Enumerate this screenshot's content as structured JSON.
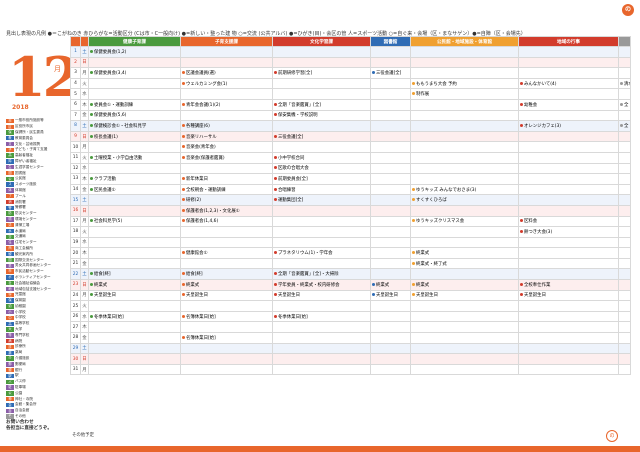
{
  "header": {
    "note": "見出し表現の凡例 ●＝こがねのき 赤ひらがな=活動区分 (Cは市・C一般向け) ●=新しい・整った建 物 ○=交流 (公共アルバ) ●=ひがき(目)・会区の管 人=スポーツ活動 ○=自ぐ来・会場（区・まなサゲン）●=自陣（区・会場先）"
  },
  "brand": {
    "logo_text": "の"
  },
  "sidebar": {
    "month": "12",
    "month_suffix": "月",
    "year": "2018",
    "legend": [
      {
        "key": "市",
        "label": "一般市役所施設等",
        "color": "#e8662c"
      },
      {
        "key": "区",
        "label": "区役所市民",
        "color": "#e8662c"
      },
      {
        "key": "保",
        "label": "保健所・民生委員",
        "color": "#4a9a3e"
      },
      {
        "key": "教",
        "label": "教育委員会",
        "color": "#2f6cb5"
      },
      {
        "key": "文",
        "label": "文化・芸術振興",
        "color": "#8b5ea8"
      },
      {
        "key": "子",
        "label": "子ども・子育て支援",
        "color": "#e8662c"
      },
      {
        "key": "高",
        "label": "高齢者福祉",
        "color": "#4a9a3e"
      },
      {
        "key": "障",
        "label": "障がい者福祉",
        "color": "#2f6cb5"
      },
      {
        "key": "生",
        "label": "生涯学習センター",
        "color": "#8b5ea8"
      },
      {
        "key": "図",
        "label": "図書館",
        "color": "#e8662c"
      },
      {
        "key": "公",
        "label": "公民館",
        "color": "#4a9a3e"
      },
      {
        "key": "ス",
        "label": "スポーツ施設",
        "color": "#2f6cb5"
      },
      {
        "key": "体",
        "label": "体育館",
        "color": "#8b5ea8"
      },
      {
        "key": "プ",
        "label": "プール",
        "color": "#e8662c"
      },
      {
        "key": "消",
        "label": "消防署",
        "color": "#d23c2c"
      },
      {
        "key": "警",
        "label": "警察署",
        "color": "#2f6cb5"
      },
      {
        "key": "防",
        "label": "防災センター",
        "color": "#4a9a3e"
      },
      {
        "key": "環",
        "label": "環境センター",
        "color": "#8b5ea8"
      },
      {
        "key": "清",
        "label": "清掃工場",
        "color": "#e8662c"
      },
      {
        "key": "水",
        "label": "水道局",
        "color": "#2f6cb5"
      },
      {
        "key": "交",
        "label": "交通局",
        "color": "#4a9a3e"
      },
      {
        "key": "住",
        "label": "住宅センター",
        "color": "#8b5ea8"
      },
      {
        "key": "商",
        "label": "商工会議所",
        "color": "#e8662c"
      },
      {
        "key": "観",
        "label": "観光案内所",
        "color": "#2f6cb5"
      },
      {
        "key": "国",
        "label": "国際交流センター",
        "color": "#4a9a3e"
      },
      {
        "key": "男",
        "label": "男女共同参画センター",
        "color": "#8b5ea8"
      },
      {
        "key": "市",
        "label": "市民活動センター",
        "color": "#e8662c"
      },
      {
        "key": "ボ",
        "label": "ボランティアセンター",
        "color": "#2f6cb5"
      },
      {
        "key": "社",
        "label": "社会福祉協議会",
        "color": "#4a9a3e"
      },
      {
        "key": "地",
        "label": "地域包括支援センター",
        "color": "#8b5ea8"
      },
      {
        "key": "児",
        "label": "児童館",
        "color": "#e8662c"
      },
      {
        "key": "保",
        "label": "保育園",
        "color": "#2f6cb5"
      },
      {
        "key": "幼",
        "label": "幼稚園",
        "color": "#4a9a3e"
      },
      {
        "key": "小",
        "label": "小学校",
        "color": "#8b5ea8"
      },
      {
        "key": "中",
        "label": "中学校",
        "color": "#e8662c"
      },
      {
        "key": "高",
        "label": "高等学校",
        "color": "#2f6cb5"
      },
      {
        "key": "大",
        "label": "大学",
        "color": "#4a9a3e"
      },
      {
        "key": "専",
        "label": "専門学校",
        "color": "#8b5ea8"
      },
      {
        "key": "病",
        "label": "病院",
        "color": "#d23c2c"
      },
      {
        "key": "診",
        "label": "診療所",
        "color": "#e8662c"
      },
      {
        "key": "薬",
        "label": "薬局",
        "color": "#2f6cb5"
      },
      {
        "key": "介",
        "label": "介護施設",
        "color": "#4a9a3e"
      },
      {
        "key": "郵",
        "label": "郵便局",
        "color": "#8b5ea8"
      },
      {
        "key": "銀",
        "label": "銀行",
        "color": "#e8662c"
      },
      {
        "key": "駅",
        "label": "駅",
        "color": "#2f6cb5"
      },
      {
        "key": "バ",
        "label": "バス停",
        "color": "#4a9a3e"
      },
      {
        "key": "駐",
        "label": "駐車場",
        "color": "#8b5ea8"
      },
      {
        "key": "公",
        "label": "公園",
        "color": "#4a9a3e"
      },
      {
        "key": "神",
        "label": "神社・寺院",
        "color": "#e8662c"
      },
      {
        "key": "会",
        "label": "会館・集会所",
        "color": "#2f6cb5"
      },
      {
        "key": "自",
        "label": "自治会館",
        "color": "#8b5ea8"
      },
      {
        "key": "そ",
        "label": "その他",
        "color": "#999999"
      }
    ],
    "contact": "お問い合わせ\n各担当に直接どうぞ。"
  },
  "columns": [
    {
      "label": "",
      "color": "#e8662c"
    },
    {
      "label": "",
      "color": "#e8662c"
    },
    {
      "label": "健康子育課",
      "color": "#4a9a3e"
    },
    {
      "label": "子育支援課",
      "color": "#e8662c"
    },
    {
      "label": "文化学習課",
      "color": "#d23c2c"
    },
    {
      "label": "図書館",
      "color": "#2f6cb5"
    },
    {
      "label": "公民館・地域施設・体育館",
      "color": "#f0a030"
    },
    {
      "label": "地域の行事",
      "color": "#d23c2c"
    },
    {
      "label": "",
      "color": "#999999"
    }
  ],
  "days": [
    {
      "d": "1",
      "wd": "土",
      "type": "sat",
      "c": [
        "保健委員会(1,2)",
        "",
        "",
        "",
        "",
        "",
        ""
      ]
    },
    {
      "d": "2",
      "wd": "日",
      "type": "sun",
      "c": [
        "",
        "",
        "",
        "",
        "",
        "",
        ""
      ]
    },
    {
      "d": "3",
      "wd": "月",
      "type": "",
      "c": [
        "保健委員会(3,4)",
        "区議会議員(選)",
        "前期研修学習[全]",
        "三役会議[全]",
        "",
        "",
        ""
      ]
    },
    {
      "d": "4",
      "wd": "火",
      "type": "",
      "c": [
        "",
        "ウェルカミング会(1)",
        "",
        "",
        "ももうまち大会 予約",
        "みんなかいて(4)",
        "清水ラッシュ体操"
      ]
    },
    {
      "d": "5",
      "wd": "水",
      "type": "",
      "c": [
        "",
        "",
        "",
        "",
        "制作展",
        "",
        ""
      ]
    },
    {
      "d": "6",
      "wd": "木",
      "type": "",
      "c": [
        "委員会①・運動訓練",
        "青年会会議(1)(2)",
        "全期「音楽鑑賞」[全]",
        "",
        "",
        "幼稚会",
        "全"
      ]
    },
    {
      "d": "7",
      "wd": "金",
      "type": "",
      "c": [
        "保健委員会(5,6)",
        "",
        "保安集機・学校説明",
        "",
        "",
        "",
        ""
      ]
    },
    {
      "d": "8",
      "wd": "土",
      "type": "sat",
      "c": [
        "保健検診会①・社会科見学",
        "各種講座(6)",
        "",
        "",
        "",
        "オレンジカフェ(3)",
        "全"
      ]
    },
    {
      "d": "9",
      "wd": "日",
      "type": "sun",
      "c": [
        "校長会議(1)",
        "音楽リハーサル",
        "三役会議[全]",
        "",
        "",
        "",
        ""
      ]
    },
    {
      "d": "10",
      "wd": "月",
      "type": "",
      "c": [
        "",
        "音楽会(青年会)",
        "",
        "",
        "",
        "",
        ""
      ]
    },
    {
      "d": "11",
      "wd": "火",
      "type": "",
      "c": [
        "土曜授業・小学自由活動",
        "音楽会(保護者鑑賞)",
        "小中学校合同",
        "",
        "",
        "",
        ""
      ]
    },
    {
      "d": "12",
      "wd": "水",
      "type": "",
      "c": [
        "",
        "",
        "区歌の合唱大会",
        "",
        "",
        "",
        ""
      ]
    },
    {
      "d": "13",
      "wd": "木",
      "type": "",
      "c": [
        "クラブ活動",
        "新年休業日",
        "前期委員会[全]",
        "",
        "",
        "",
        ""
      ]
    },
    {
      "d": "14",
      "wd": "金",
      "type": "",
      "c": [
        "区民会議①",
        "全校朝会・運動訓練",
        "合唱練習",
        "",
        "ゆうキッズ みんなでおさま(3)",
        "",
        ""
      ]
    },
    {
      "d": "15",
      "wd": "土",
      "type": "sat",
      "c": [
        "",
        "研修(2)",
        "運動集団[全]",
        "",
        "すくすくひろば",
        "",
        ""
      ]
    },
    {
      "d": "16",
      "wd": "日",
      "type": "sun",
      "c": [
        "",
        "保護者会(1,2,3)・文化展①",
        "",
        "",
        "",
        "",
        ""
      ]
    },
    {
      "d": "17",
      "wd": "月",
      "type": "",
      "c": [
        "社会科見学(5)",
        "保護者会(1,4,6)",
        "",
        "",
        "ゆうキッズクリスマス会",
        "区料会",
        ""
      ]
    },
    {
      "d": "18",
      "wd": "火",
      "type": "",
      "c": [
        "",
        "",
        "",
        "",
        "",
        "餅つき大会(3)",
        ""
      ]
    },
    {
      "d": "19",
      "wd": "水",
      "type": "",
      "c": [
        "",
        "",
        "",
        "",
        "",
        "",
        ""
      ]
    },
    {
      "d": "20",
      "wd": "木",
      "type": "",
      "c": [
        "",
        "健康館会①",
        "プラネタリウム(1)・学年会",
        "",
        "終業式",
        "",
        ""
      ]
    },
    {
      "d": "21",
      "wd": "金",
      "type": "",
      "c": [
        "",
        "",
        "",
        "",
        "終業式・終了式",
        "",
        ""
      ]
    },
    {
      "d": "22",
      "wd": "土",
      "type": "sat",
      "c": [
        "給食[終]",
        "給食[終]",
        "全期「音楽鑑賞」[全]・大掃除",
        "",
        "",
        "",
        ""
      ]
    },
    {
      "d": "23",
      "wd": "日",
      "type": "sun",
      "c": [
        "終業式",
        "終業式",
        "学年委員・終業式・校内研修会",
        "終業式",
        "終業式",
        "全校奉仕作業",
        ""
      ]
    },
    {
      "d": "24",
      "wd": "月",
      "type": "",
      "c": [
        "天皇誕生日",
        "天皇誕生日",
        "天皇誕生日",
        "天皇誕生日",
        "天皇誕生日",
        "天皇誕生日",
        ""
      ]
    },
    {
      "d": "25",
      "wd": "火",
      "type": "",
      "c": [
        "",
        "",
        "",
        "",
        "",
        "",
        ""
      ]
    },
    {
      "d": "26",
      "wd": "水",
      "type": "",
      "c": [
        "冬季休業日[始]",
        "名簿休業日[始]",
        "冬季休業日[始]",
        "",
        "",
        "",
        ""
      ]
    },
    {
      "d": "27",
      "wd": "木",
      "type": "",
      "c": [
        "",
        "",
        "",
        "",
        "",
        "",
        ""
      ]
    },
    {
      "d": "28",
      "wd": "金",
      "type": "",
      "c": [
        "",
        "名簿休業日[始]",
        "",
        "",
        "",
        "",
        ""
      ]
    },
    {
      "d": "29",
      "wd": "土",
      "type": "sat",
      "c": [
        "",
        "",
        "",
        "",
        "",
        "",
        ""
      ]
    },
    {
      "d": "30",
      "wd": "日",
      "type": "sun",
      "c": [
        "",
        "",
        "",
        "",
        "",
        "",
        ""
      ]
    },
    {
      "d": "31",
      "wd": "月",
      "type": "",
      "c": [
        "",
        "",
        "",
        "",
        "",
        "",
        ""
      ]
    }
  ],
  "footer": {
    "note": "その他予定",
    "page_mark": "の"
  }
}
